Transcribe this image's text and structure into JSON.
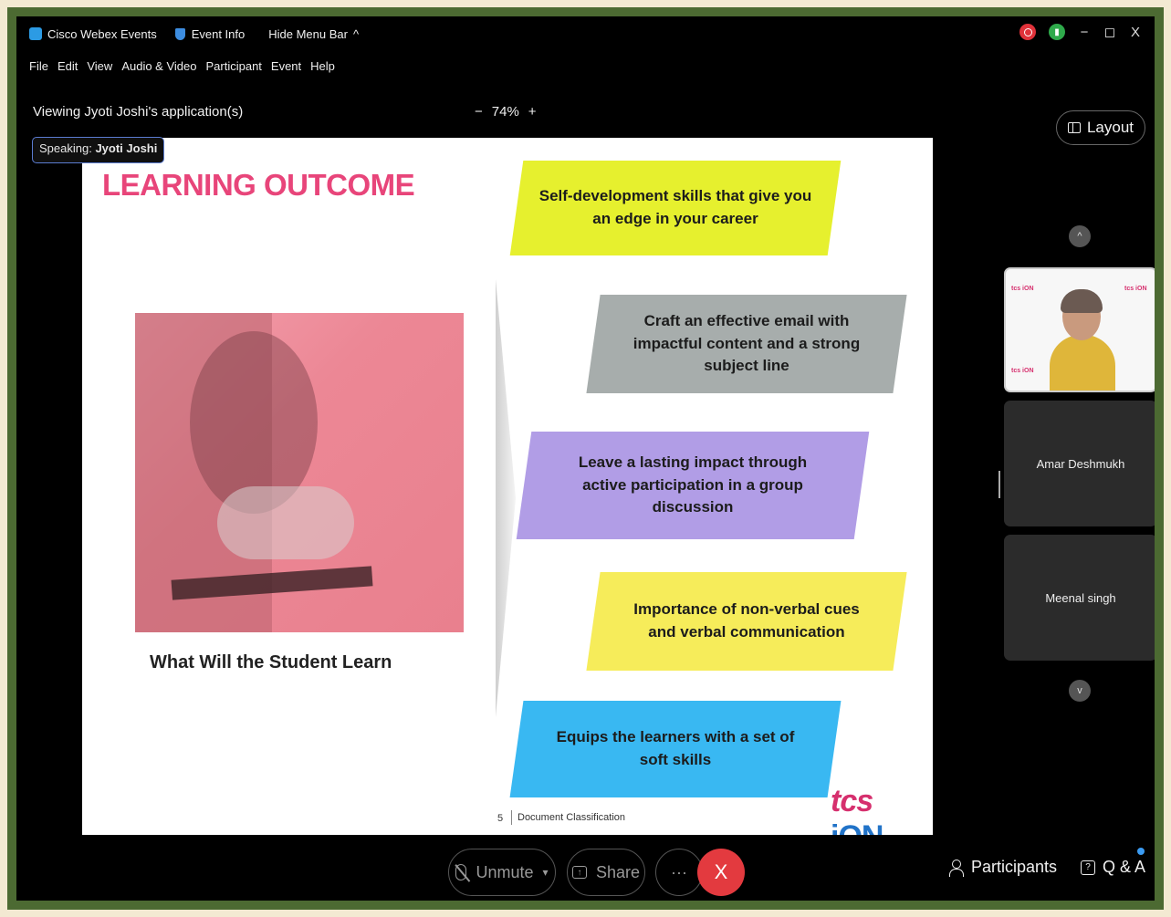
{
  "titlebar": {
    "app_name": "Cisco Webex Events",
    "event_info": "Event Info",
    "hide_menu": "Hide Menu Bar",
    "hide_menu_chevron": "^",
    "minimize": "−",
    "restore": "◻",
    "close": "X"
  },
  "menu": [
    "File",
    "Edit",
    "View",
    "Audio & Video",
    "Participant",
    "Event",
    "Help"
  ],
  "viewing": "Viewing Jyoti Joshi's application(s)",
  "zoom": {
    "minus": "−",
    "level": "74%",
    "plus": "+"
  },
  "speaking": {
    "label": "Speaking:",
    "name": "Jyoti Joshi"
  },
  "layout_button": "Layout",
  "slide": {
    "title": "LEARNING OUTCOME",
    "caption": "What Will the Student Learn",
    "outcomes": [
      {
        "text": "Self-development skills that give you an edge in your career",
        "color": "#e6f02e"
      },
      {
        "text": "Craft an effective email with impactful content and a strong subject line",
        "color": "#a7adac"
      },
      {
        "text": "Leave a lasting impact through active participation in a group discussion",
        "color": "#b19de6"
      },
      {
        "text": "Importance of non-verbal cues and verbal communication",
        "color": "#f6ec5a"
      },
      {
        "text": "Equips the learners with a set of soft skills",
        "color": "#39b8f2"
      }
    ],
    "page_number": "5",
    "footer": "Document Classification",
    "brand_tcs": "tcs",
    "brand_ion": "iON"
  },
  "participants_panel": {
    "tiles": [
      "Amar Deshmukh",
      "Meenal singh"
    ],
    "up": "^",
    "down": "v"
  },
  "controls": {
    "unmute": "Unmute",
    "share": "Share",
    "more": "···",
    "end": "X",
    "participants": "Participants",
    "qa": "Q & A"
  }
}
